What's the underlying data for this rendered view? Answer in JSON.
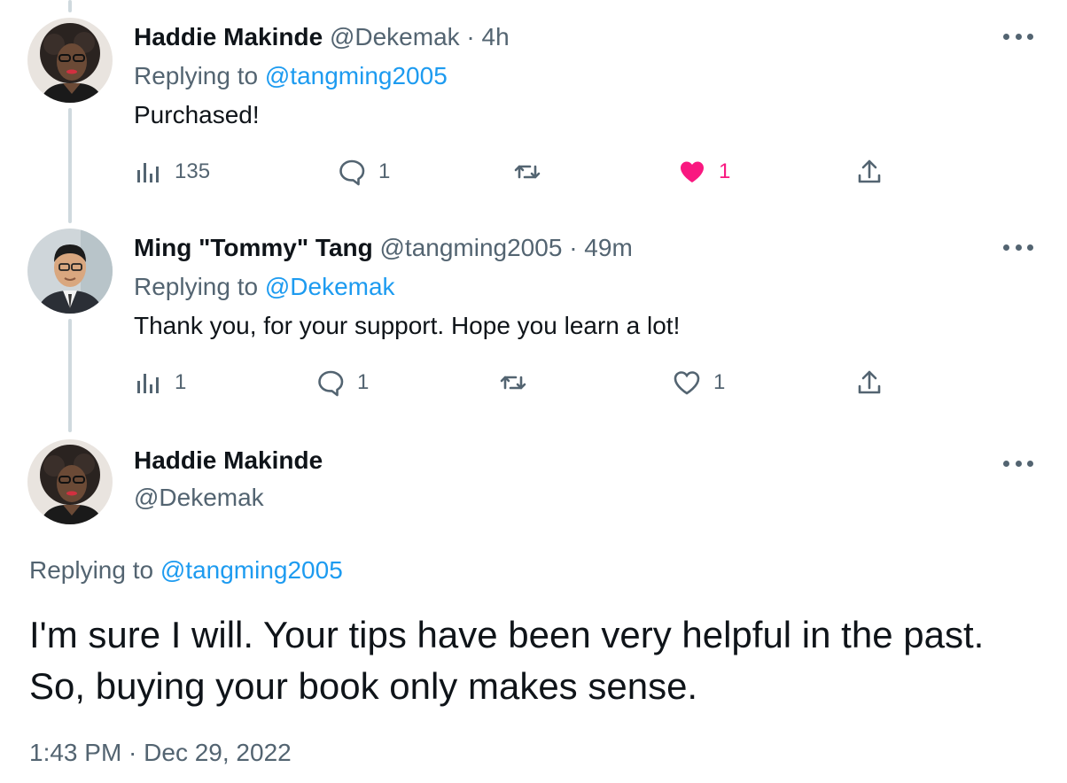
{
  "tweets": [
    {
      "display_name": "Haddie Makinde",
      "handle": "@Dekemak",
      "separator": "·",
      "time": "4h",
      "replying_prefix": "Replying to",
      "replying_to": "@tangming2005",
      "text": "Purchased!",
      "views": "135",
      "replies": "1",
      "retweets": "",
      "likes": "1",
      "liked": true,
      "avatar_icon": "profile-photo-woman"
    },
    {
      "display_name": "Ming \"Tommy\" Tang",
      "handle": "@tangming2005",
      "separator": "·",
      "time": "49m",
      "replying_prefix": "Replying to",
      "replying_to": "@Dekemak",
      "text": "Thank you, for your support. Hope you learn a lot!",
      "views": "1",
      "replies": "1",
      "retweets": "",
      "likes": "1",
      "liked": false,
      "avatar_icon": "profile-photo-man"
    }
  ],
  "main_tweet": {
    "display_name": "Haddie Makinde",
    "handle": "@Dekemak",
    "replying_prefix": "Replying to",
    "replying_to": "@tangming2005",
    "text": "I'm sure I will. Your tips have been very helpful in the past. So, buying your book only makes sense.",
    "timestamp": "1:43 PM · Dec 29, 2022",
    "avatar_icon": "profile-photo-woman"
  },
  "colors": {
    "accent": "#1d9bf0",
    "like": "#f91880",
    "muted": "#536471",
    "thread_line": "#cfd9de"
  }
}
